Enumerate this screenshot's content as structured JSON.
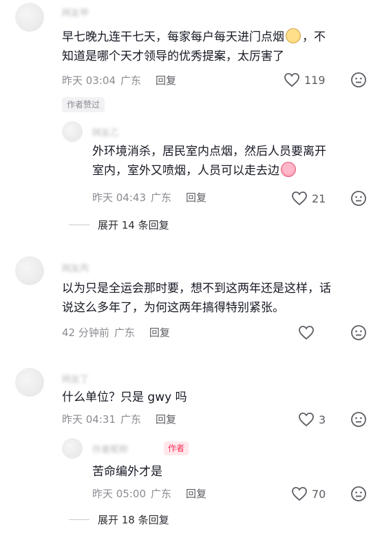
{
  "comments": [
    {
      "username": "网友甲",
      "text_line1": "早七晚九连干七天，每家每户每天进门点烟",
      "text_line1_tail": "，不",
      "text_line2": "知道是哪个天才领导的优秀提案，太厉害了",
      "emoji": "smirk-emoji",
      "time": "昨天 03:04",
      "location": "广东",
      "reply_label": "回复",
      "likes": "119",
      "badge": "作者赞过"
    },
    {
      "username": "网友乙",
      "text_line1": "外环境消杀，居民室内点烟，然后人员要离开",
      "text_line2": "室内，室外又喷烟，人员可以走去边",
      "emoji": "crying-emoji",
      "time": "昨天 04:43",
      "location": "广东",
      "reply_label": "回复",
      "likes": "21",
      "expand_label": "展开 14 条回复"
    },
    {
      "username": "网友丙",
      "text_line1": "以为只是全运会那时要，想不到这两年还是这样，话",
      "text_line2": "说这么多年了，为何这两年搞得特别紧张。",
      "time": "42 分钟前",
      "location": "广东",
      "reply_label": "回复",
      "likes": ""
    },
    {
      "username": "网友丁",
      "text_line1": "什么单位？只是 gwy 吗",
      "time": "昨天 04:31",
      "location": "广东",
      "reply_label": "回复",
      "likes": "3"
    },
    {
      "username": "作者昵称",
      "author_tag": "作者",
      "text_line1": "苦命编外才是",
      "time": "昨天 05:00",
      "location": "广东",
      "reply_label": "回复",
      "likes": "70",
      "expand_label": "展开 18 条回复"
    }
  ]
}
